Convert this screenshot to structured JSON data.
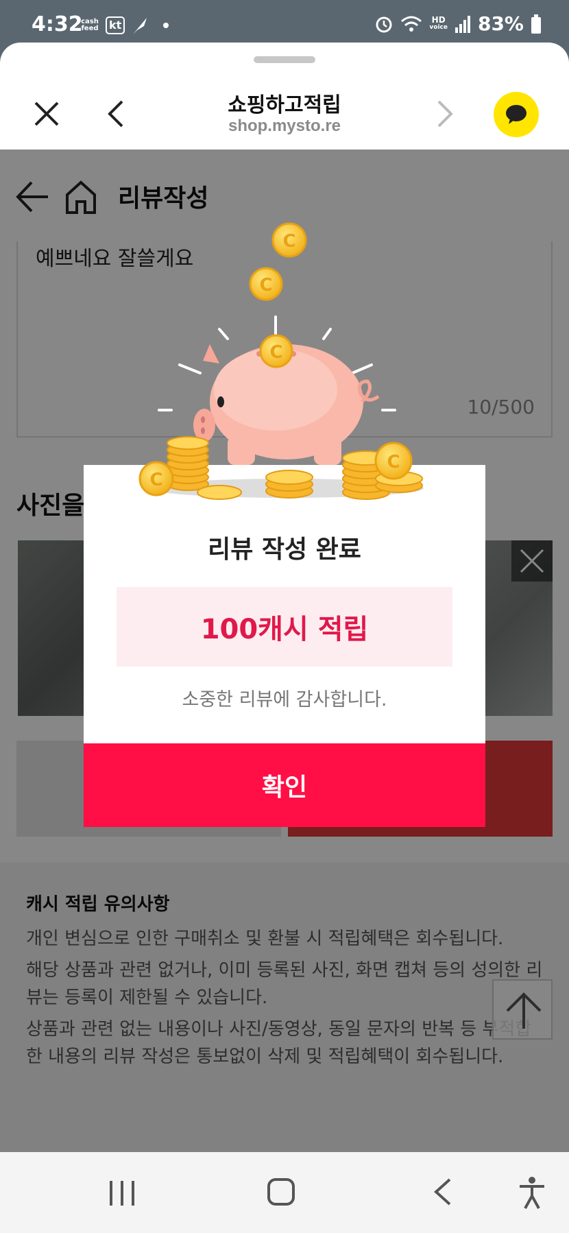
{
  "status_bar": {
    "time": "4:32",
    "cashfeed_line1": "cash",
    "cashfeed_line2": "feed",
    "carrier": "kt",
    "hd_line1": "HD",
    "hd_line2": "voice",
    "battery": "83%"
  },
  "browser": {
    "title": "쇼핑하고적립",
    "url": "shop.mysto.re"
  },
  "page": {
    "title": "리뷰작성",
    "review_text": "예쁘네요 잘쓸게요",
    "char_count": "10/500",
    "photo_heading": "사진을",
    "notice_title": "캐시 적립 유의사항",
    "notice_lines": [
      "개인 변심으로 인한 구매취소 및 환불 시 적립혜택은 회수됩니다.",
      "해당 상품과 관련 없거나, 이미 등록된 사진, 화면 캡쳐 등의 성의한 리뷰는 등록이 제한될 수 있습니다.",
      "상품과 관련 없는 내용이나 사진/동영상, 동일 문자의 반복 등 부적합한 내용의 리뷰 작성은 통보없이 삭제 및 적립혜택이 회수됩니다."
    ]
  },
  "modal": {
    "title": "리뷰 작성 완료",
    "reward": "100캐시 적립",
    "subtitle": "소중한 리뷰에 감사합니다.",
    "confirm_label": "확인"
  },
  "colors": {
    "accent": "#ff0f45",
    "reward_text": "#e0194a",
    "reward_bg": "#fdedf1",
    "talk_yellow": "#ffe500"
  }
}
